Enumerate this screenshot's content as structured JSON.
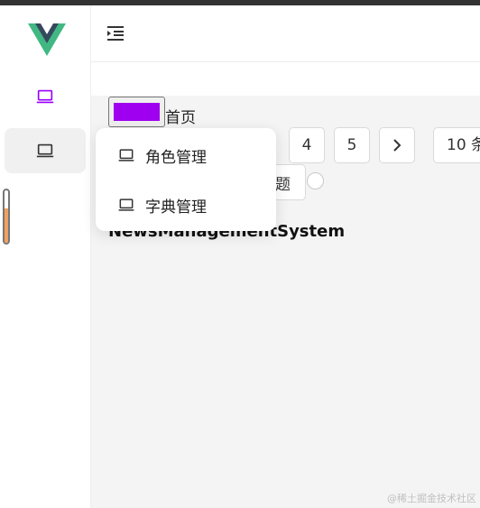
{
  "colors": {
    "accent": "#9900ff",
    "swatch": "#a000f0",
    "active_bg": "#f0f0f0",
    "content_bg": "#f4f4f4"
  },
  "sidebar": {
    "logo": "vue-logo",
    "items": [
      {
        "icon": "laptop-icon",
        "active": false,
        "color": "#9900ff"
      },
      {
        "icon": "laptop-icon",
        "active": true,
        "color": "#333333"
      }
    ],
    "scroll_toggle_level": 0.66
  },
  "header": {
    "menu_icon": "indent-menu-icon"
  },
  "color_picker": {
    "value": "#a000f0"
  },
  "breadcrumb": {
    "home": "首页"
  },
  "pagination": {
    "pages": [
      "4",
      "5"
    ],
    "next": ">",
    "page_size": "10 条"
  },
  "theme": {
    "label": "题"
  },
  "app": {
    "title": "NewsManagementSystem"
  },
  "dropdown": {
    "items": [
      {
        "icon": "laptop-icon",
        "label": "角色管理"
      },
      {
        "icon": "laptop-icon",
        "label": "字典管理"
      }
    ]
  },
  "watermark": "@稀土掘金技术社区"
}
